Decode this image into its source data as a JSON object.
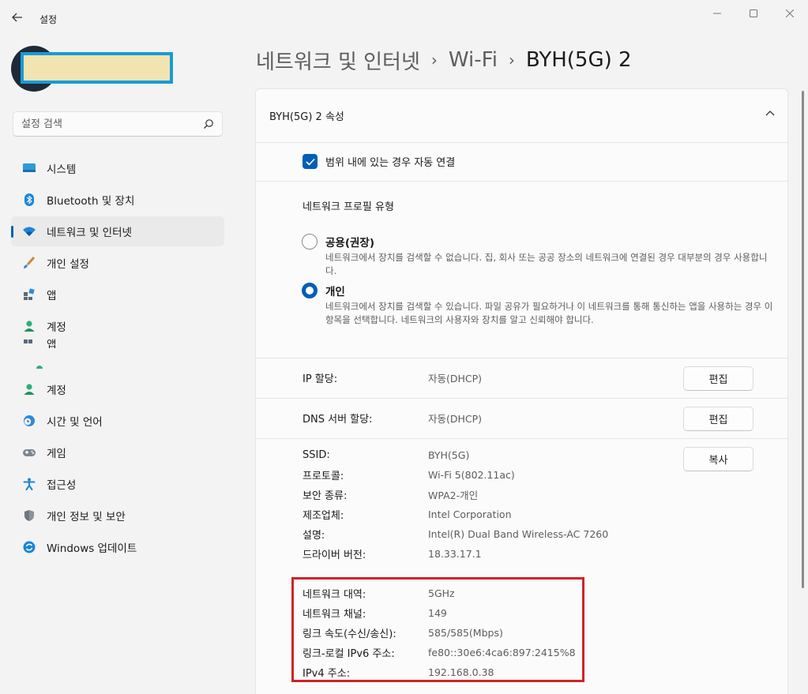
{
  "window": {
    "title": "설정",
    "back_icon": "back-arrow-icon",
    "controls": [
      "minimize-icon",
      "maximize-icon",
      "close-icon"
    ]
  },
  "search": {
    "placeholder": "설정 검색"
  },
  "sidebar": {
    "items": [
      {
        "label": "시스템",
        "icon": "system-icon"
      },
      {
        "label": "Bluetooth 및 장치",
        "icon": "bluetooth-icon"
      },
      {
        "label": "네트워크 및 인터넷",
        "icon": "wifi-icon",
        "selected": true
      },
      {
        "label": "개인 설정",
        "icon": "brush-icon"
      },
      {
        "label": "앱",
        "icon": "apps-icon"
      },
      {
        "label": "계정",
        "icon": "account-icon"
      },
      {
        "label": "계정",
        "icon": "account-icon"
      },
      {
        "label": "시간 및 언어",
        "icon": "clock-globe-icon"
      },
      {
        "label": "게임",
        "icon": "gamepad-icon"
      },
      {
        "label": "접근성",
        "icon": "accessibility-icon"
      },
      {
        "label": "개인 정보 및 보안",
        "icon": "shield-icon"
      },
      {
        "label": "Windows 업데이트",
        "icon": "update-icon"
      }
    ],
    "ghost_label": "앱"
  },
  "breadcrumb": {
    "items": [
      "네트워크 및 인터넷",
      "Wi-Fi"
    ],
    "current": "BYH(5G) 2"
  },
  "card": {
    "title": "BYH(5G) 2 속성",
    "auto_connect": {
      "label": "범위 내에 있는 경우 자동 연결",
      "checked": true
    },
    "profile": {
      "title": "네트워크 프로필 유형",
      "options": [
        {
          "title": "공용(권장)",
          "desc": "네트워크에서 장치를 검색할 수 없습니다. 집, 회사 또는 공공 장소의 네트워크에 연결된 경우 대부분의 경우 사용합니다.",
          "selected": false
        },
        {
          "title": "개인",
          "desc": "네트워크에서 장치를 검색할 수 있습니다. 파일 공유가 필요하거나 이 네트워크를 통해 통신하는 앱을 사용하는 경우 이 항목을 선택합니다. 네트워크의 사용자와 장치를 알고 신뢰해야 합니다.",
          "selected": true
        }
      ]
    },
    "ip_assignment": {
      "label": "IP 할당:",
      "value": "자동(DHCP)",
      "button": "편집"
    },
    "dns_assignment": {
      "label": "DNS 서버 할당:",
      "value": "자동(DHCP)",
      "button": "편집"
    },
    "copy_button": "복사",
    "properties": [
      {
        "label": "SSID:",
        "value": "BYH(5G)"
      },
      {
        "label": "프로토콜:",
        "value": "Wi-Fi 5(802.11ac)"
      },
      {
        "label": "보안 종류:",
        "value": "WPA2-개인"
      },
      {
        "label": "제조업체:",
        "value": "Intel Corporation"
      },
      {
        "label": "설명:",
        "value": "Intel(R) Dual Band Wireless-AC 7260"
      },
      {
        "label": "드라이버 버전:",
        "value": "18.33.17.1"
      },
      {
        "label": "네트워크 대역:",
        "value": "5GHz"
      },
      {
        "label": "네트워크 채널:",
        "value": "149"
      },
      {
        "label": "링크 속도(수신/송신):",
        "value": "585/585(Mbps)"
      },
      {
        "label": "링크-로컬 IPv6 주소:",
        "value": "fe80::30e6:4ca6:897:2415%8"
      },
      {
        "label": "IPv4 주소:",
        "value": "192.168.0.38"
      }
    ]
  },
  "colors": {
    "accent": "#005fb8",
    "highlight_border": "#d1222a",
    "name_redaction": "#f1e4b0",
    "name_redaction_border": "#1a9ad6"
  }
}
